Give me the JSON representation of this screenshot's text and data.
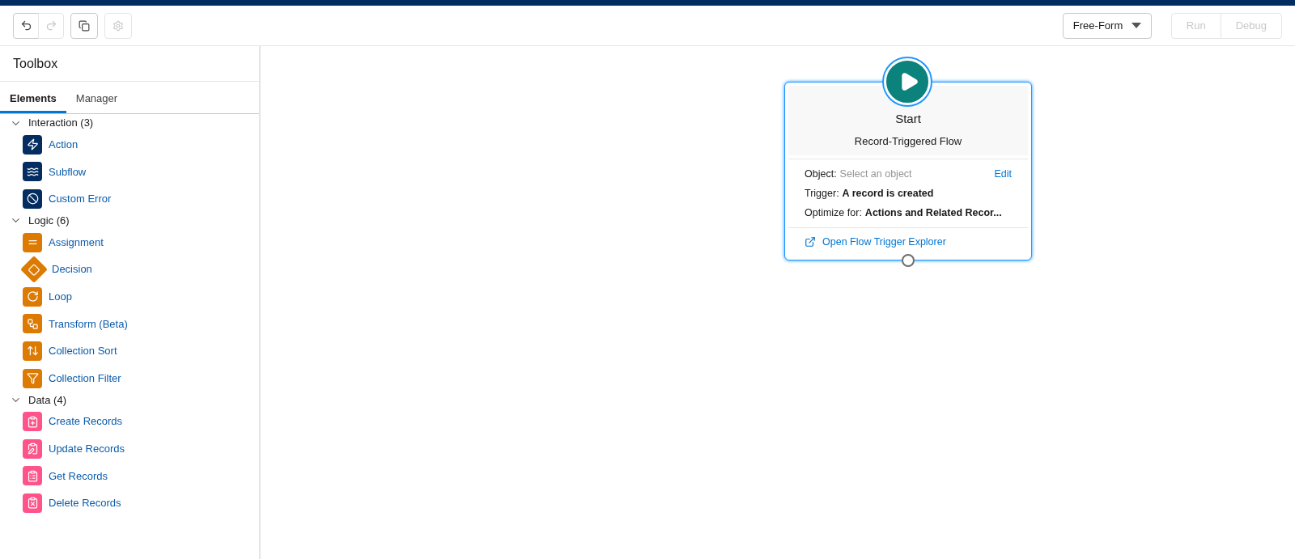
{
  "toolbar": {
    "buttons": [
      {
        "kind": "undo",
        "disabled": false
      },
      {
        "kind": "redo",
        "disabled": true
      },
      {
        "kind": "copy",
        "disabled": false
      },
      {
        "kind": "settings",
        "disabled": true
      }
    ],
    "layout_select": {
      "value": "Free-Form"
    },
    "actions": [
      {
        "label": "Run",
        "disabled": true
      },
      {
        "label": "Debug",
        "disabled": true
      }
    ]
  },
  "toolbox": {
    "title": "Toolbox",
    "tabs": [
      {
        "label": "Elements",
        "selected": true
      },
      {
        "label": "Manager",
        "selected": false
      }
    ],
    "groups": [
      {
        "label": "Interaction (3)",
        "expanded": true,
        "color": "#032d60",
        "items": [
          {
            "label": "Action",
            "kind": "bolt"
          },
          {
            "label": "Subflow",
            "kind": "waves"
          },
          {
            "label": "Custom Error",
            "kind": "ban"
          }
        ]
      },
      {
        "label": "Logic (6)",
        "expanded": true,
        "color": "#dd7a01",
        "items": [
          {
            "label": "Assignment",
            "kind": "equal"
          },
          {
            "label": "Decision",
            "kind": "diamond"
          },
          {
            "label": "Loop",
            "kind": "loop"
          },
          {
            "label": "Transform (Beta)",
            "kind": "transform"
          },
          {
            "label": "Collection Sort",
            "kind": "sort"
          },
          {
            "label": "Collection Filter",
            "kind": "filter"
          }
        ]
      },
      {
        "label": "Data (4)",
        "expanded": true,
        "color": "#ff538a",
        "items": [
          {
            "label": "Create Records",
            "kind": "create"
          },
          {
            "label": "Update Records",
            "kind": "update"
          },
          {
            "label": "Get Records",
            "kind": "get"
          },
          {
            "label": "Delete Records",
            "kind": "delete"
          }
        ]
      }
    ]
  },
  "start_node": {
    "title": "Start",
    "subtitle": "Record-Triggered Flow",
    "selected": true,
    "fields": [
      {
        "label": "Object:",
        "value": "Select an object",
        "kind": "unset",
        "action": "Edit"
      },
      {
        "label": "Trigger:",
        "value": "A record is created",
        "kind": "bold"
      },
      {
        "label": "Optimize for:",
        "value": "Actions and Related Recor...",
        "kind": "bold"
      }
    ],
    "link": "Open Flow Trigger Explorer"
  }
}
